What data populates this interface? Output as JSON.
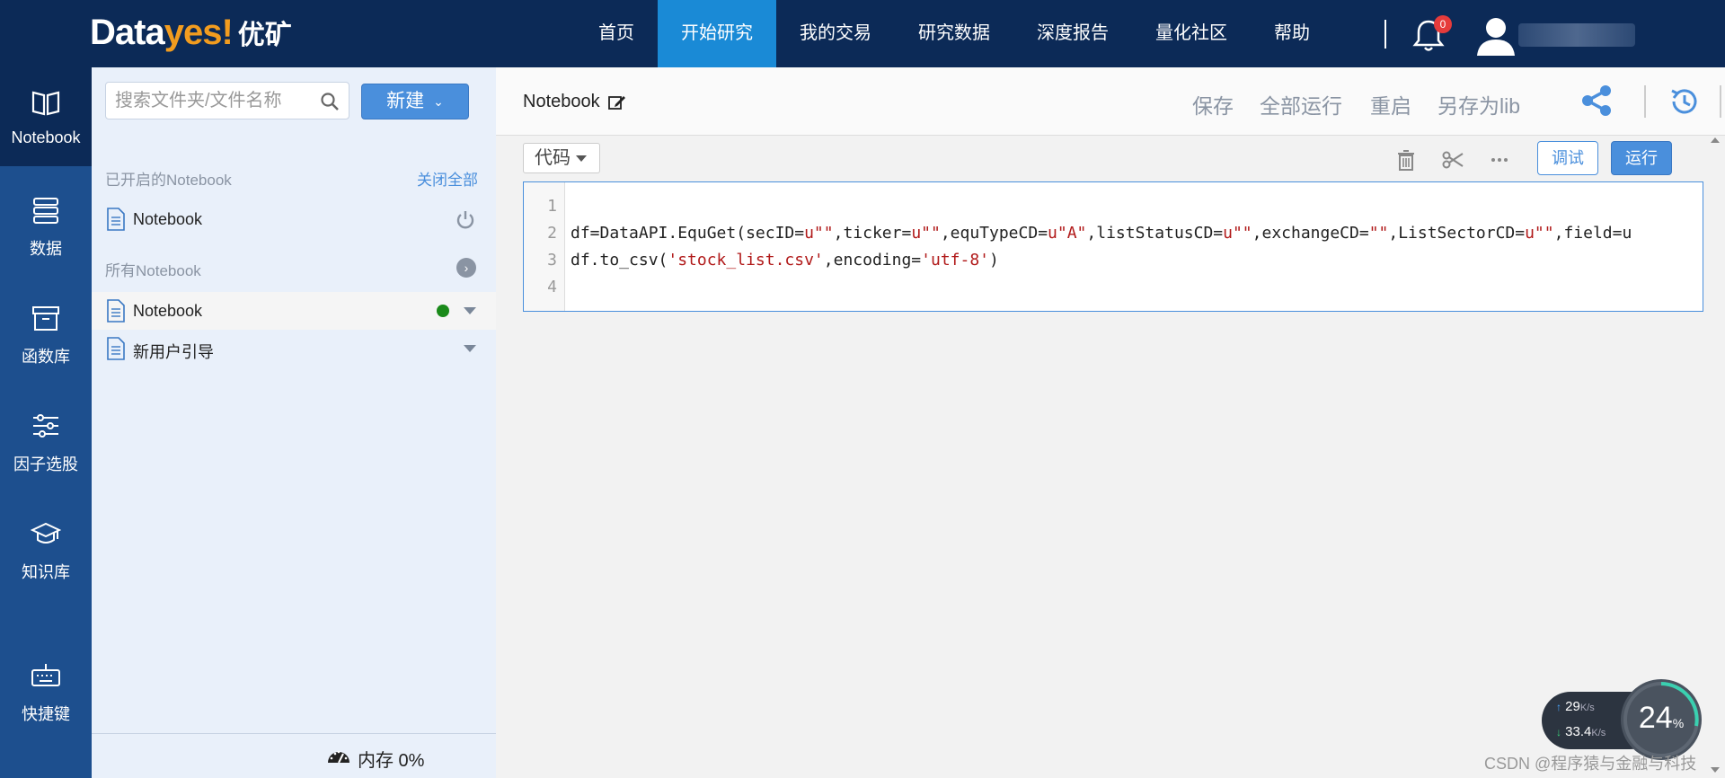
{
  "logo": {
    "data": "Data",
    "yes": "yes!",
    "cn": "优矿"
  },
  "nav": [
    "首页",
    "开始研究",
    "我的交易",
    "研究数据",
    "深度报告",
    "量化社区",
    "帮助"
  ],
  "nav_active_index": 1,
  "notifications": {
    "count": "0"
  },
  "rail": [
    {
      "label": "Notebook",
      "icon": "book-icon"
    },
    {
      "label": "数据",
      "icon": "database-icon"
    },
    {
      "label": "函数库",
      "icon": "archive-box-icon"
    },
    {
      "label": "因子选股",
      "icon": "sliders-icon"
    },
    {
      "label": "知识库",
      "icon": "graduation-cap-icon"
    },
    {
      "label": "快捷键",
      "icon": "keyboard-icon"
    }
  ],
  "sidebar": {
    "search_placeholder": "搜索文件夹/文件名称",
    "new_button": "新建",
    "opened_title": "已开启的Notebook",
    "close_all": "关闭全部",
    "opened_items": [
      "Notebook"
    ],
    "all_title": "所有Notebook",
    "all_items": [
      "Notebook",
      "新用户引导"
    ],
    "memory": "内存 0%"
  },
  "toolbar": {
    "title": "Notebook",
    "save": "保存",
    "run_all": "全部运行",
    "restart": "重启",
    "save_as_lib": "另存为lib"
  },
  "cell": {
    "type_select": "代码",
    "debug": "调试",
    "run": "运行",
    "line_numbers": [
      "1",
      "2",
      "3",
      "4"
    ],
    "lines": [
      "",
      "df=DataAPI.EquGet(secID=u\"\",ticker=u\"\",equTypeCD=u\"A\",listStatusCD=u\"\",exchangeCD=\"\",ListSectorCD=u\"\",field=u",
      "df.to_csv('stock_list.csv',encoding='utf-8')",
      ""
    ]
  },
  "net": {
    "up": "29",
    "up_unit": "K/s",
    "down": "33.4",
    "down_unit": "K/s",
    "cpu": "24",
    "cpu_unit": "%"
  },
  "watermark": "CSDN @程序猿与金融与科技"
}
